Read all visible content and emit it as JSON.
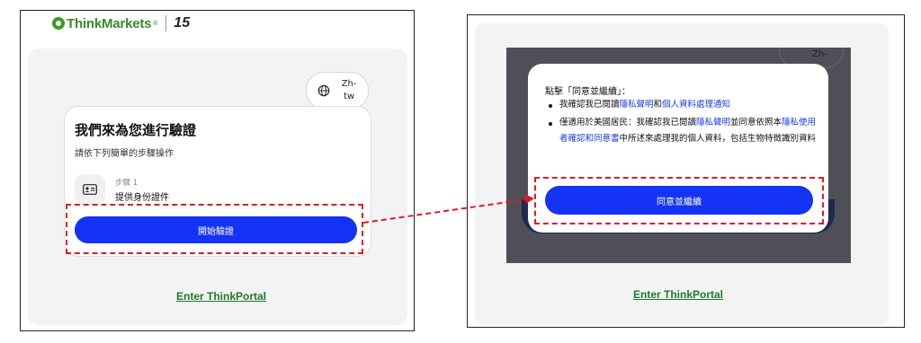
{
  "left_panel": {
    "logo": {
      "brand": "ThinkMarkets",
      "trademark": "®",
      "badge": "15"
    },
    "language": {
      "label": "Zh-tw",
      "icon": "globe-icon"
    },
    "verification": {
      "title": "我們來為您進行驗證",
      "subtitle": "請依下列簡單的步驟操作",
      "step": {
        "icon": "id-card-icon",
        "label": "步驟 1",
        "text": "提供身份證件"
      },
      "start_button": "開始驗證"
    },
    "portal_link": "Enter ThinkPortal"
  },
  "right_panel": {
    "background_language": "Zh-",
    "consent_modal": {
      "title": "點擊「同意並繼續」：",
      "bullet1": {
        "prefix": "我確認我已閱讀",
        "link1": "隱私聲明",
        "middle": "和",
        "link2": "個人資料處理通知"
      },
      "bullet2": {
        "prefix": "僅適用於美國居民：我確認我已閱讀",
        "link1": "隱私聲明",
        "middle": "並同意依照本",
        "link2": "隱私使用者確認和同意書",
        "suffix": "中所述來處理我的個人資料，包括生物特徵識別資料"
      },
      "agree_button": "同意並繼續"
    },
    "portal_link": "Enter ThinkPortal"
  },
  "colors": {
    "primary_button": "#1433f5",
    "highlight_dash": "#e01b24",
    "brand_green": "#3a8a2a",
    "link_blue": "#1a3be0",
    "overlay": "#4f5057"
  }
}
